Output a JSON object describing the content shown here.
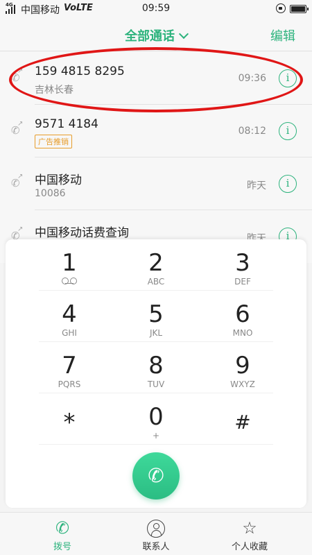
{
  "status_bar": {
    "signal_tag": "4G",
    "carrier": "中国移动",
    "volte": "VoLTE",
    "time": "09:59"
  },
  "header": {
    "title": "全部通话",
    "edit_label": "编辑"
  },
  "call_log": [
    {
      "number": "159 4815 8295",
      "location": "吉林长春",
      "time": "09:36",
      "tag": ""
    },
    {
      "number": "9571 4184",
      "location": "",
      "time": "08:12",
      "tag": "广告推销"
    },
    {
      "number": "中国移动",
      "location": "10086",
      "time": "昨天",
      "tag": ""
    },
    {
      "number": "中国移动话费查询",
      "location": "",
      "time": "昨天",
      "tag": ""
    }
  ],
  "dialpad": {
    "keys": [
      {
        "digit": "1",
        "letters": ""
      },
      {
        "digit": "2",
        "letters": "ABC"
      },
      {
        "digit": "3",
        "letters": "DEF"
      },
      {
        "digit": "4",
        "letters": "GHI"
      },
      {
        "digit": "5",
        "letters": "JKL"
      },
      {
        "digit": "6",
        "letters": "MNO"
      },
      {
        "digit": "7",
        "letters": "PQRS"
      },
      {
        "digit": "8",
        "letters": "TUV"
      },
      {
        "digit": "9",
        "letters": "WXYZ"
      },
      {
        "digit": "*",
        "letters": ""
      },
      {
        "digit": "0",
        "letters": "+"
      },
      {
        "digit": "#",
        "letters": ""
      }
    ],
    "call_icon": "phone-icon"
  },
  "bottom_nav": {
    "tabs": [
      {
        "label": "拨号",
        "icon": "phone-icon",
        "active": true
      },
      {
        "label": "联系人",
        "icon": "contact-icon",
        "active": false
      },
      {
        "label": "个人收藏",
        "icon": "star-icon",
        "active": false
      }
    ]
  },
  "colors": {
    "accent": "#2db37d",
    "highlight_circle": "#e01616",
    "ad_tag": "#e79c2a"
  },
  "info_glyph": "i"
}
